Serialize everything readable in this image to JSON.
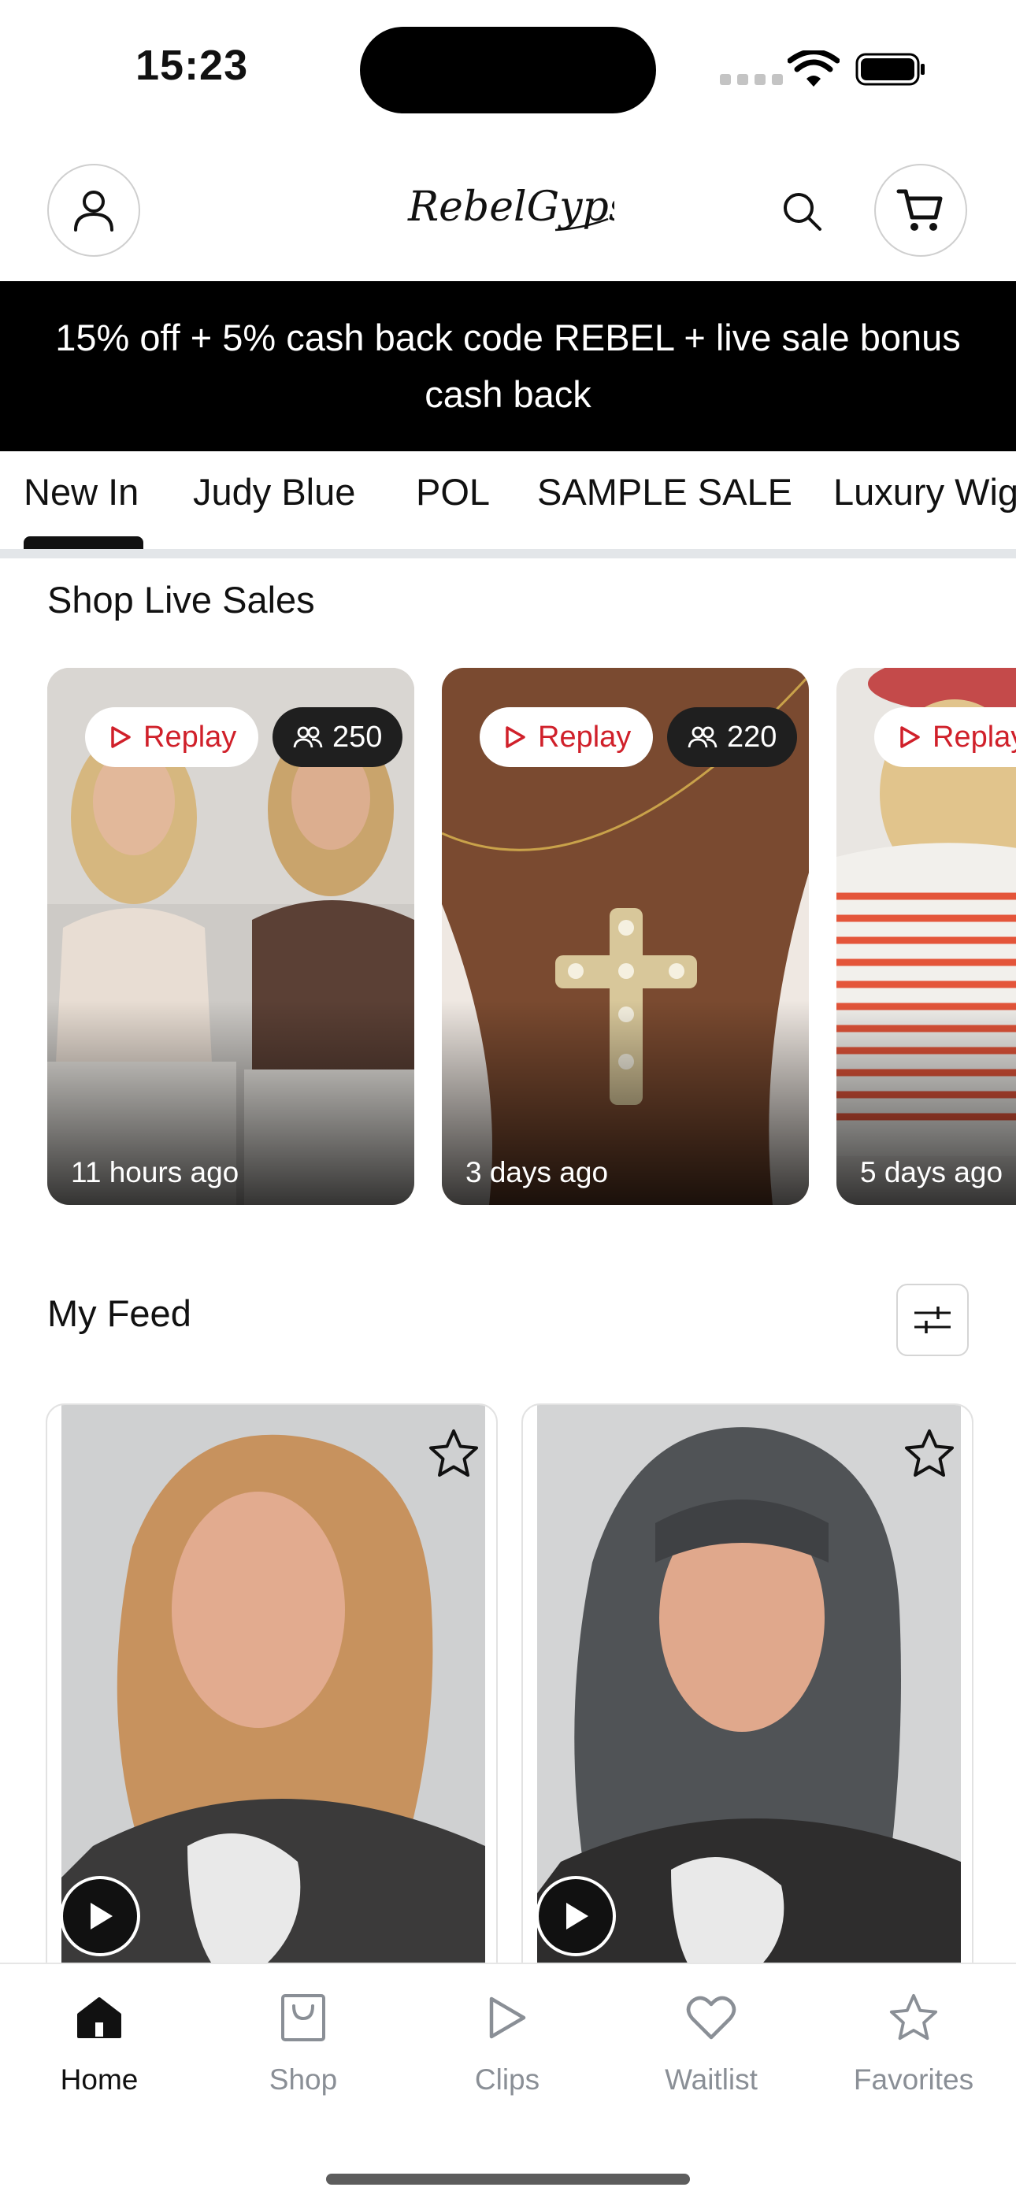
{
  "status_bar": {
    "time": "15:23"
  },
  "header": {
    "logo_text": "RebelGypsy"
  },
  "promo": {
    "text": "15% off + 5% cash back code REBEL + live sale bonus cash back"
  },
  "tabs": [
    {
      "label": "New In",
      "active": true
    },
    {
      "label": "Judy Blue"
    },
    {
      "label": "POL"
    },
    {
      "label": "SAMPLE SALE"
    },
    {
      "label": "Luxury Wigs"
    }
  ],
  "live_sales": {
    "title": "Shop Live Sales",
    "cards": [
      {
        "badge": "Replay",
        "viewers": "250",
        "time_ago": "11 hours ago"
      },
      {
        "badge": "Replay",
        "viewers": "220",
        "time_ago": "3 days ago"
      },
      {
        "badge": "Replay",
        "time_ago": "5 days ago"
      }
    ]
  },
  "feed": {
    "title": "My Feed"
  },
  "bottom_nav": [
    {
      "label": "Home",
      "icon": "home-icon",
      "active": true
    },
    {
      "label": "Shop",
      "icon": "bag-icon"
    },
    {
      "label": "Clips",
      "icon": "play-icon"
    },
    {
      "label": "Waitlist",
      "icon": "heart-icon"
    },
    {
      "label": "Favorites",
      "icon": "star-icon"
    }
  ],
  "colors": {
    "accent": "#d0202a",
    "promo_bg": "#000000",
    "inactive_nav": "#8a8f96"
  }
}
